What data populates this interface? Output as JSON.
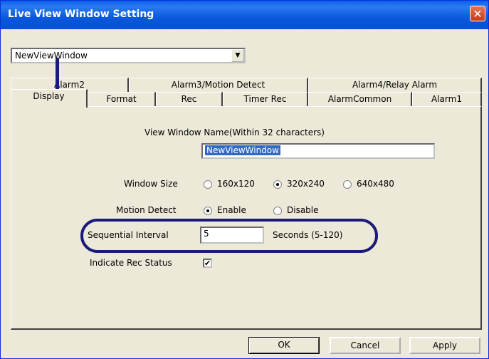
{
  "window": {
    "title": "Live View Window Setting",
    "close_glyph": "✕"
  },
  "view_select": {
    "value": "NewViewWindow",
    "dropdown_glyph": "▼"
  },
  "tabs": {
    "row1": [
      "Alarm2",
      "Alarm3/Motion Detect",
      "Alarm4/Relay Alarm"
    ],
    "row2": [
      "Display",
      "Format",
      "Rec",
      "Timer Rec",
      "AlarmCommon",
      "Alarm1"
    ],
    "active": "Display"
  },
  "form": {
    "name_label": "View Window Name(Within 32 characters)",
    "name_value": "NewViewWindow",
    "window_size_label": "Window Size",
    "window_size_options": [
      "160x120",
      "320x240",
      "640x480"
    ],
    "window_size_selected": "320x240",
    "motion_detect_label": "Motion Detect",
    "motion_detect_options": [
      "Enable",
      "Disable"
    ],
    "motion_detect_selected": "Enable",
    "sequential_interval_label": "Sequential Interval",
    "sequential_interval_value": "5",
    "sequential_interval_unit": "Seconds (5-120)",
    "indicate_rec_label": "Indicate Rec Status",
    "indicate_rec_checked": true,
    "check_glyph": "✔"
  },
  "buttons": {
    "ok": "OK",
    "cancel": "Cancel",
    "apply": "Apply"
  },
  "colors": {
    "titlebar": "#0a58dc",
    "annotation": "#1a1a78",
    "selection": "#316ac5"
  }
}
